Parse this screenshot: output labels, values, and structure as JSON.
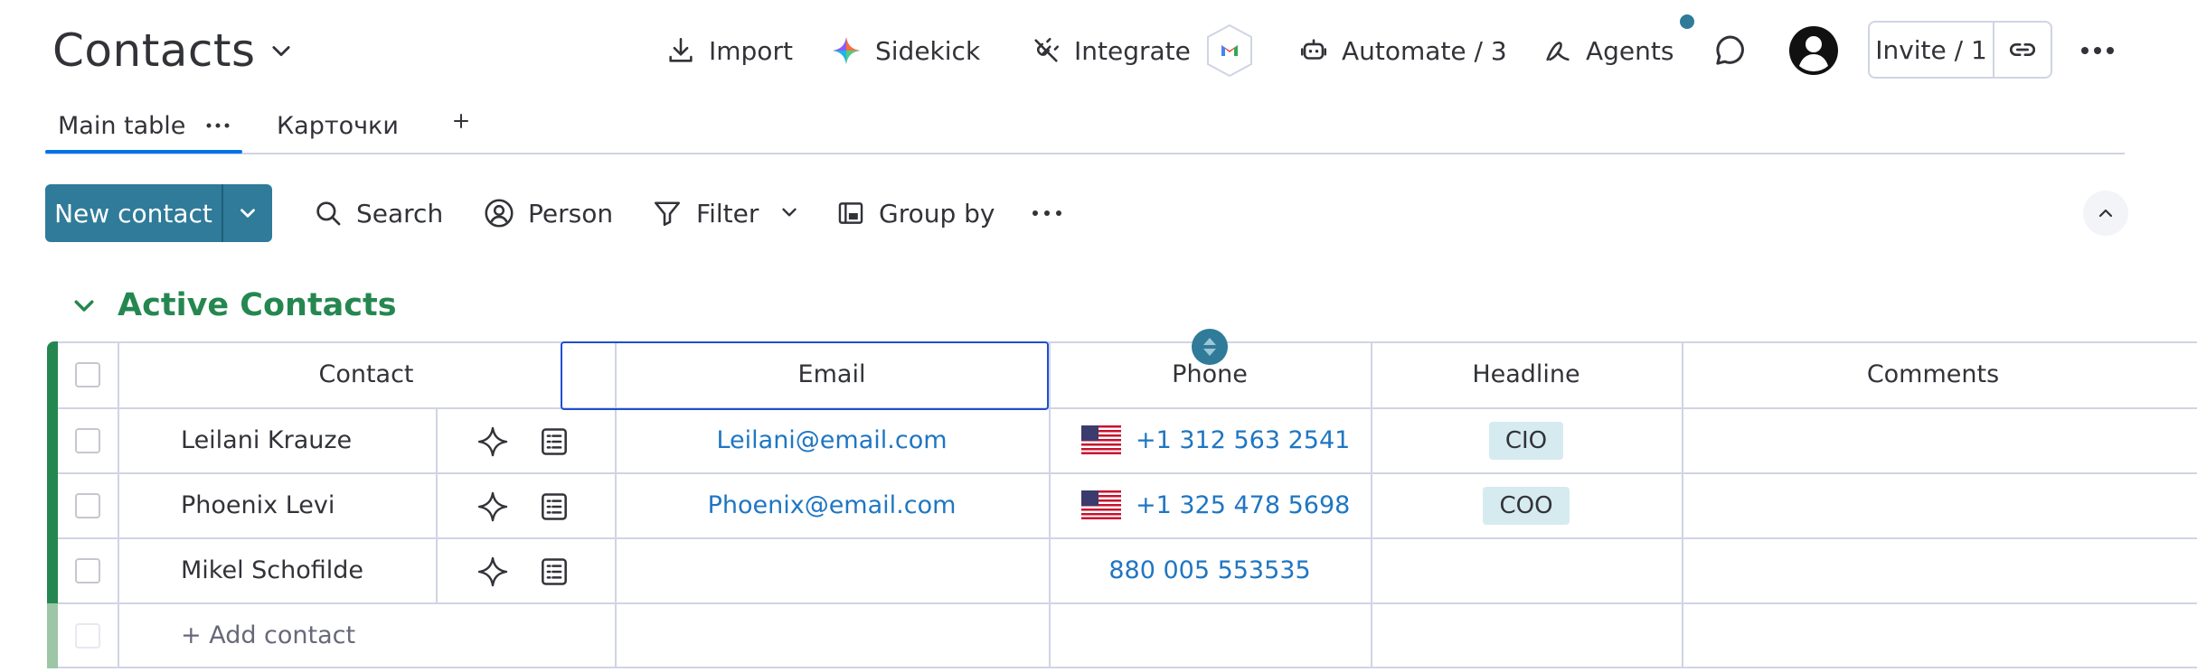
{
  "header": {
    "title": "Contacts",
    "import_label": "Import",
    "sidekick_label": "Sidekick",
    "integrate_label": "Integrate",
    "automate_label": "Automate / 3",
    "agents_label": "Agents",
    "invite_label": "Invite / 1"
  },
  "tabs": [
    {
      "label": "Main table"
    },
    {
      "label": "Карточки"
    }
  ],
  "actions": {
    "new_contact_label": "New contact",
    "search_label": "Search",
    "person_label": "Person",
    "filter_label": "Filter",
    "group_by_label": "Group by"
  },
  "group": {
    "title": "Active Contacts",
    "color": "#258750"
  },
  "table": {
    "columns": [
      "Contact",
      "Email",
      "Phone",
      "Headline",
      "Comments"
    ],
    "rows": [
      {
        "name": "Leilani Krauze",
        "email": "Leilani@email.com",
        "phone": "+1 312 563 2541",
        "headline": "CIO"
      },
      {
        "name": "Phoenix Levi",
        "email": "Phoenix@email.com",
        "phone": "+1 325 478 5698",
        "headline": "COO"
      },
      {
        "name": "Mikel Schofilde",
        "email": "",
        "phone": "880 005 553535",
        "headline": ""
      }
    ],
    "add_row_label": "+ Add contact"
  },
  "colors": {
    "primary_button": "#2f7b99",
    "link": "#1f76c2",
    "badge": "#d5ebf0",
    "group_green": "#258750"
  }
}
